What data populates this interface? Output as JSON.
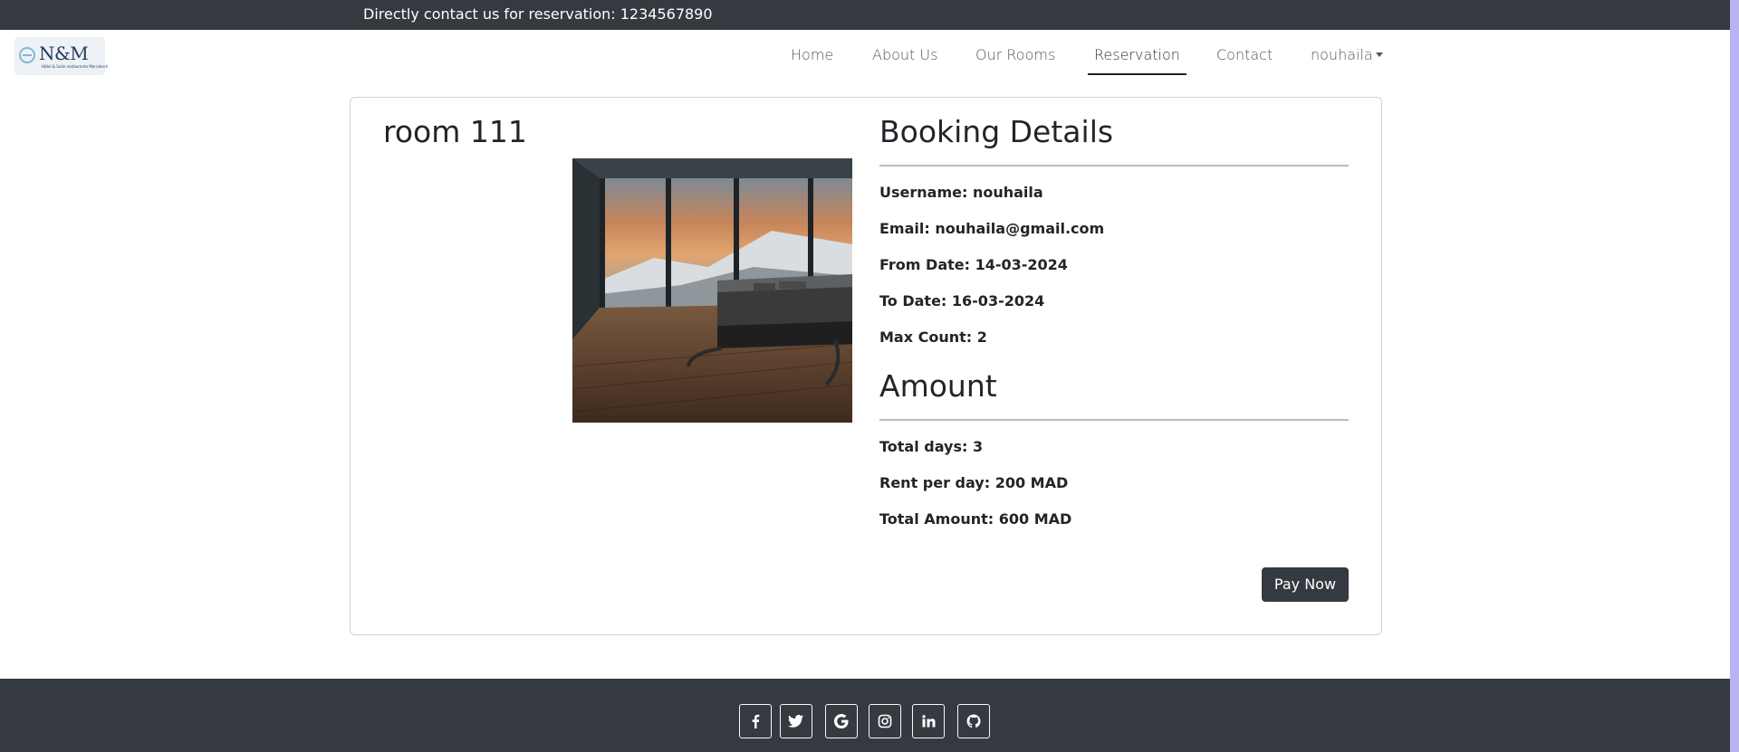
{
  "topbar": {
    "contact_text": "Directly contact us for reservation: 1234567890"
  },
  "brand": {
    "logo_text": "N&M",
    "logo_sub": "Hôtel & Suite restaurante Marrakech"
  },
  "nav": {
    "items": [
      {
        "label": "Home",
        "active": false
      },
      {
        "label": "About Us",
        "active": false
      },
      {
        "label": "Our Rooms",
        "active": false
      },
      {
        "label": "Reservation",
        "active": true
      },
      {
        "label": "Contact",
        "active": false
      },
      {
        "label": "nouhaila",
        "active": false,
        "dropdown": true
      }
    ]
  },
  "room": {
    "title": "room 111",
    "carousel": {
      "slides": 2,
      "active_slide": 2
    }
  },
  "booking": {
    "heading": "Booking Details",
    "username": "Username: nouhaila",
    "email": "Email: nouhaila@gmail.com",
    "from_date": "From Date: 14-03-2024",
    "to_date": "To Date: 16-03-2024",
    "max_count": "Max Count: 2"
  },
  "amount": {
    "heading": "Amount",
    "total_days": "Total days: 3",
    "rent_per_day": "Rent per day: 200 MAD",
    "total_amount": "Total Amount: 600 MAD"
  },
  "actions": {
    "pay_label": "Pay Now"
  },
  "footer": {
    "social": [
      "facebook-icon",
      "twitter-icon",
      "google-icon",
      "instagram-icon",
      "linkedin-icon",
      "github-icon"
    ]
  },
  "colors": {
    "dark": "#343a40",
    "accent_scroll": "#b9b3f2"
  }
}
